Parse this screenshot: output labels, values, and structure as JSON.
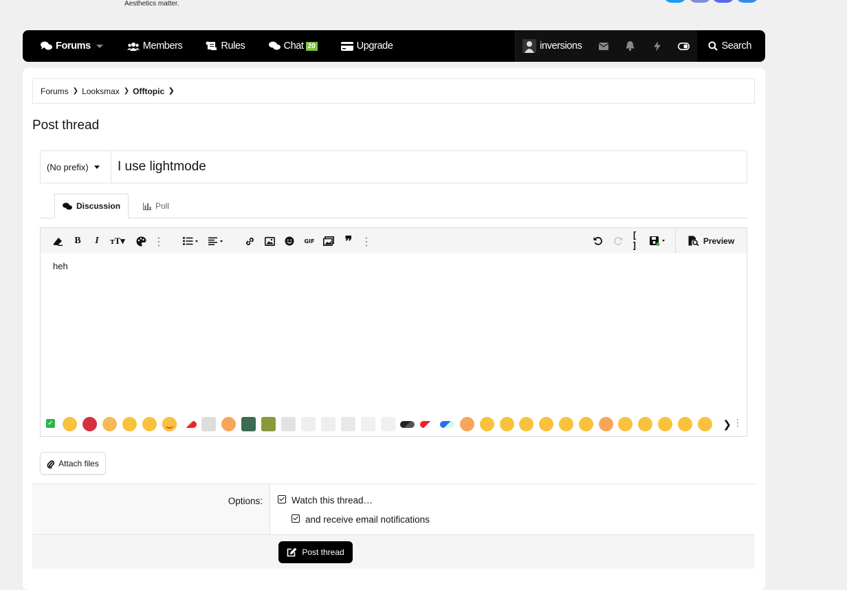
{
  "header": {
    "tagline": "Aesthetics matter."
  },
  "nav": {
    "forums": "Forums",
    "members": "Members",
    "rules": "Rules",
    "chat": "Chat",
    "chat_badge": "20",
    "upgrade": "Upgrade",
    "username": "inversions",
    "search": "Search"
  },
  "breadcrumb": [
    "Forums",
    "Looksmax",
    "Offtopic"
  ],
  "page_title": "Post thread",
  "form": {
    "prefix": "(No prefix)",
    "title_value": "I use lightmode",
    "tabs": [
      "Discussion",
      "Poll"
    ],
    "preview": "Preview",
    "body": "heh",
    "attach": "Attach files",
    "options_label": "Options:",
    "watch": "Watch this thread…",
    "email": "and receive email notifications",
    "submit": "Post thread"
  },
  "colors": {
    "accent": "#000000",
    "chat_badge": "#7cc243",
    "check_green": "#2db54a"
  }
}
